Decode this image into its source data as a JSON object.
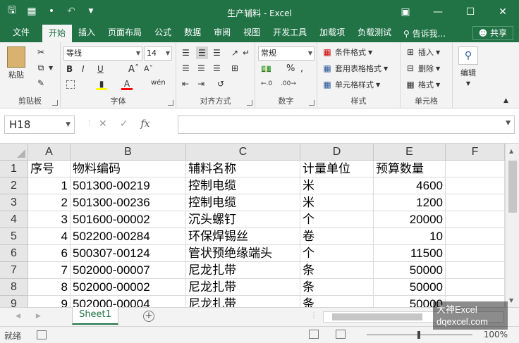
{
  "title": "生产辅料 - Excel",
  "tabs": [
    "文件",
    "开始",
    "插入",
    "页面布局",
    "公式",
    "数据",
    "审阅",
    "视图",
    "开发工具",
    "加载项",
    "负载测试"
  ],
  "tell_me": "告诉我...",
  "share": "共享",
  "ribbon": {
    "clipboard": {
      "paste": "粘贴",
      "label": "剪贴板"
    },
    "font": {
      "name": "等线",
      "size": "14",
      "label": "字体",
      "bold": "B",
      "italic": "I",
      "underline": "U"
    },
    "alignment": {
      "label": "对齐方式"
    },
    "number": {
      "format": "常规",
      "percent": "%",
      "label": "数字"
    },
    "styles": {
      "conditional": "条件格式",
      "table": "套用表格格式",
      "cell": "单元格样式",
      "label": "样式"
    },
    "cells": {
      "insert": "插入",
      "delete": "删除",
      "format": "格式",
      "label": "单元格"
    },
    "editing": {
      "label": "编辑"
    }
  },
  "name_box": "H18",
  "fx": "fx",
  "columns": [
    "A",
    "B",
    "C",
    "D",
    "E",
    "F"
  ],
  "rows": [
    {
      "n": "1",
      "a": "序号",
      "b": "物料编码",
      "c": "辅料名称",
      "d": "计量单位",
      "e": "预算数量"
    },
    {
      "n": "2",
      "a": "1",
      "b": "501300-00219",
      "c": "控制电缆",
      "d": "米",
      "e": "4600"
    },
    {
      "n": "3",
      "a": "2",
      "b": "501300-00236",
      "c": "控制电缆",
      "d": "米",
      "e": "1200"
    },
    {
      "n": "4",
      "a": "3",
      "b": "501600-00002",
      "c": "沉头螺钉",
      "d": "个",
      "e": "20000"
    },
    {
      "n": "5",
      "a": "4",
      "b": "502200-00284",
      "c": "环保焊锡丝",
      "d": "卷",
      "e": "10"
    },
    {
      "n": "6",
      "a": "6",
      "b": "500307-00124",
      "c": "管状预绝缘端头",
      "d": "个",
      "e": "11500"
    },
    {
      "n": "7",
      "a": "7",
      "b": "502000-00007",
      "c": "尼龙扎带",
      "d": "条",
      "e": "50000"
    },
    {
      "n": "8",
      "a": "8",
      "b": "502000-00002",
      "c": "尼龙扎带",
      "d": "条",
      "e": "50000"
    },
    {
      "n": "9",
      "a": "9",
      "b": "502000-00004",
      "c": "尼龙扎带",
      "d": "条",
      "e": "50000"
    }
  ],
  "sheet_tab": "Sheet1",
  "status": "就绪",
  "zoom": "100%",
  "watermark": {
    "line1": "大神Excel",
    "line2": "dqexcel.com"
  },
  "colors": {
    "accent": "#217346"
  }
}
